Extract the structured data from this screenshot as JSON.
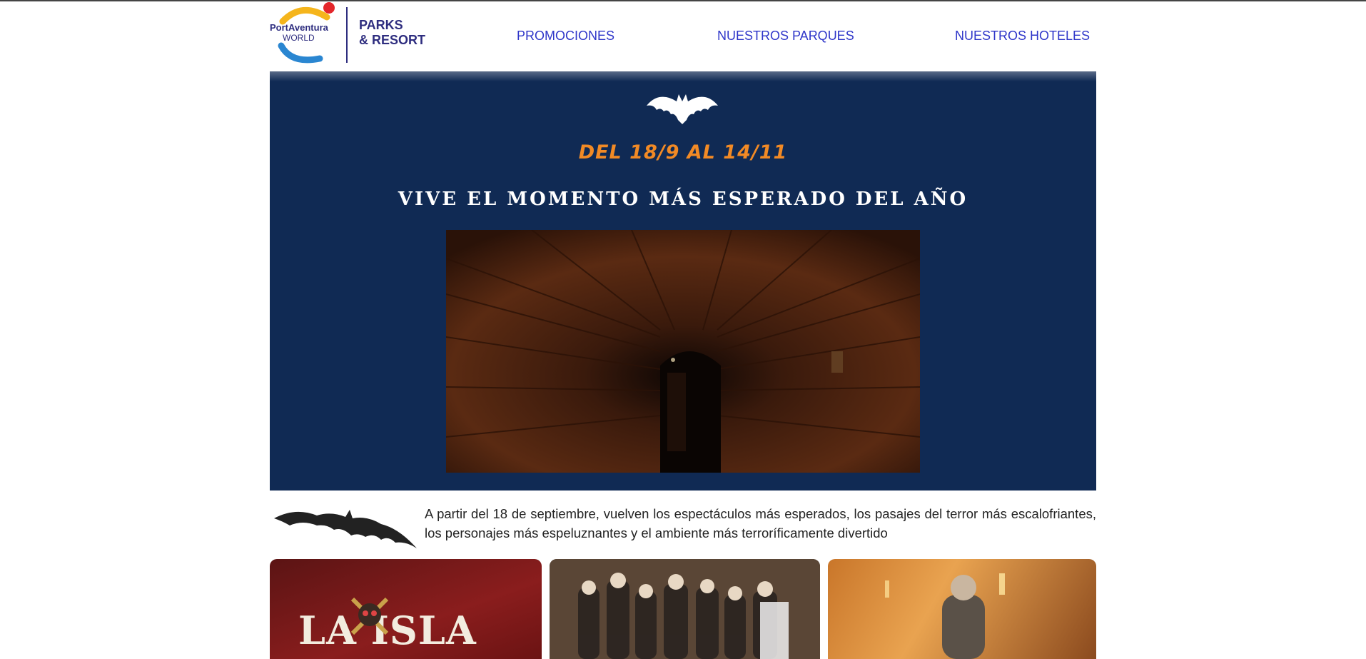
{
  "logo": {
    "brand_line1": "PortAventura",
    "brand_line2": "WORLD",
    "suffix_line1": "PARKS",
    "suffix_line2": "& RESORT"
  },
  "nav": {
    "items": [
      {
        "label": "PROMOCIONES"
      },
      {
        "label": "NUESTROS PARQUES"
      },
      {
        "label": "NUESTROS HOTELES"
      }
    ]
  },
  "hero": {
    "dates": "DEL 18/9 AL 14/11",
    "tagline": "VIVE EL MOMENTO MÁS ESPERADO DEL AÑO",
    "video_icon": "tunnel-video-thumbnail"
  },
  "intro": {
    "text": "A partir del 18 de septiembre, vuelven los espectáculos más esperados, los pasajes del terror más escalofriantes, los personajes más espeluznantes y el ambiente más terroríficamente divertido"
  },
  "cards": [
    {
      "title": "LA ISLA"
    },
    {
      "title": ""
    },
    {
      "title": ""
    }
  ],
  "colors": {
    "hero_bg": "#102a54",
    "accent_orange": "#f28a25",
    "nav_blue": "#2f36c9",
    "brand_navy": "#2e2d7f"
  }
}
